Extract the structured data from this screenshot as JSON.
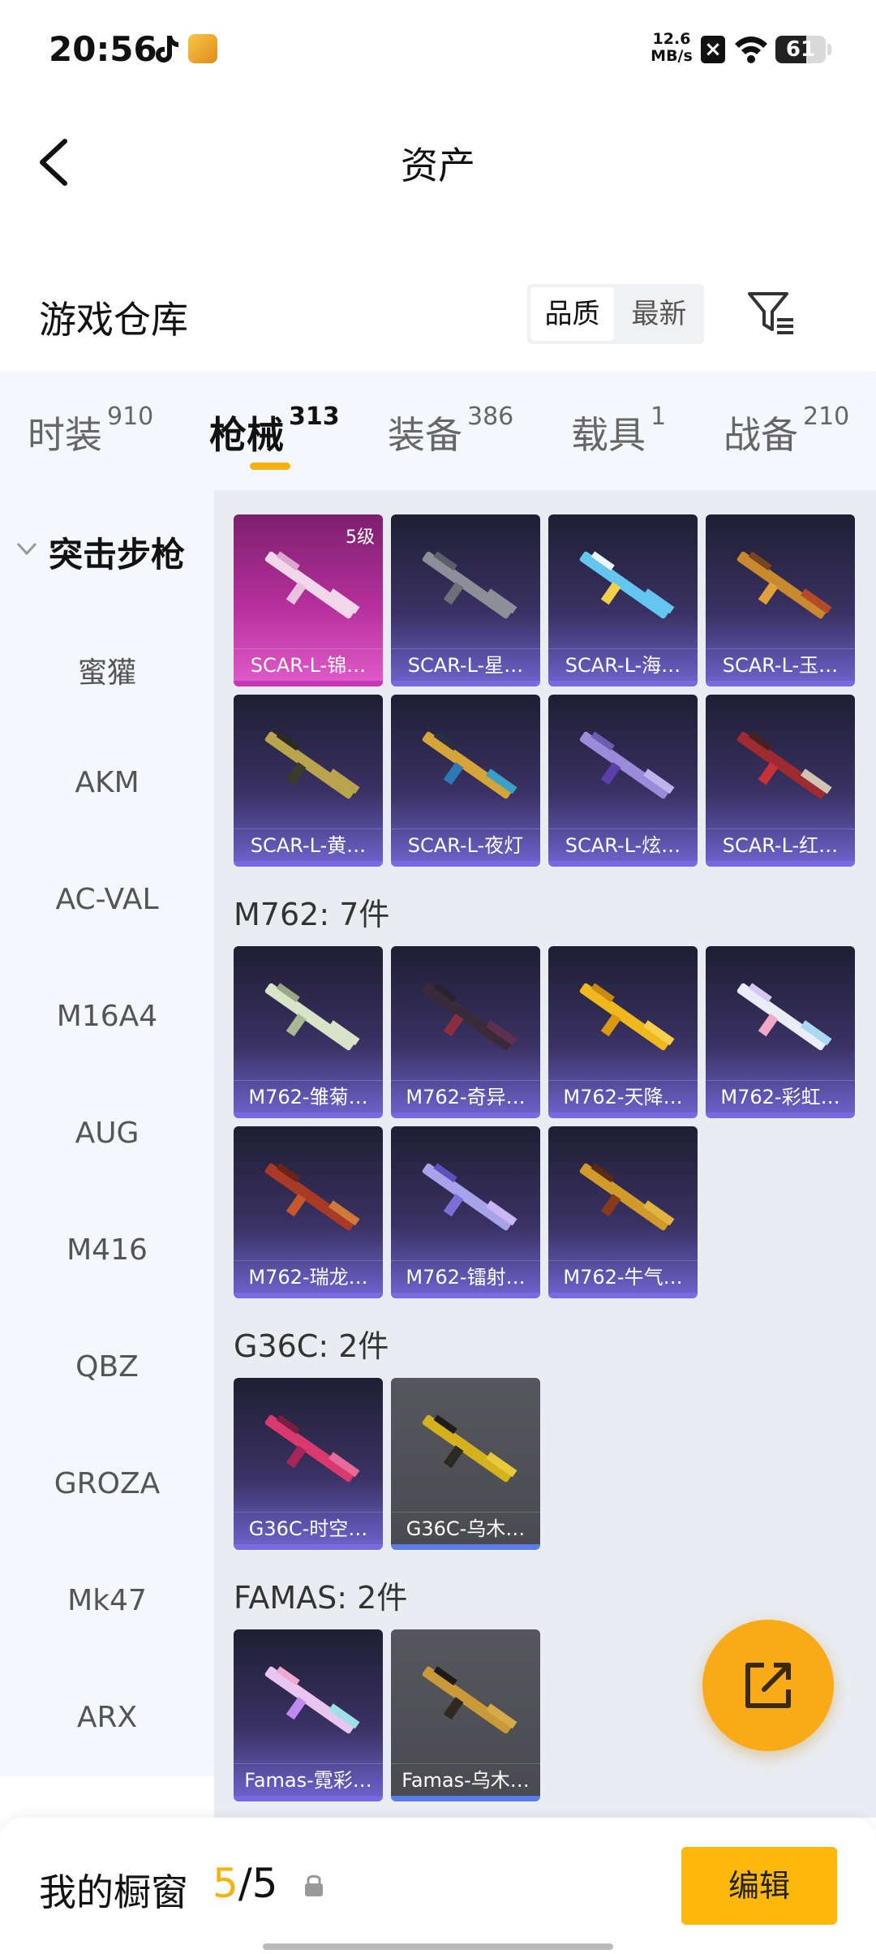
{
  "status_bar": {
    "time": "20:56",
    "net_speed_value": "12.6",
    "net_speed_unit": "MB/s",
    "battery": "61",
    "battery_level": 0.61
  },
  "header": {
    "title": "资产",
    "back_icon": "back-arrow-icon"
  },
  "warehouse": {
    "title": "游戏仓库",
    "sort_options": [
      "品质",
      "最新"
    ],
    "active_sort": "品质",
    "filter_icon": "filter-icon"
  },
  "tabs": [
    {
      "label": "时装",
      "count": "910"
    },
    {
      "label": "枪械",
      "count": "313",
      "active": true
    },
    {
      "label": "装备",
      "count": "386"
    },
    {
      "label": "载具",
      "count": "1"
    },
    {
      "label": "战备",
      "count": "210"
    }
  ],
  "rail": {
    "heading": "突击步枪",
    "items": [
      "蜜獾",
      "AKM",
      "AC-VAL",
      "M16A4",
      "AUG",
      "M416",
      "QBZ",
      "GROZA",
      "Mk47",
      "ARX"
    ]
  },
  "sections": [
    {
      "title": "",
      "items": [
        {
          "label": "SCAR-L-锦…",
          "badge": "5级",
          "style": "pink"
        },
        {
          "label": "SCAR-L-星…"
        },
        {
          "label": "SCAR-L-海…"
        },
        {
          "label": "SCAR-L-玉…"
        },
        {
          "label": "SCAR-L-黄…"
        },
        {
          "label": "SCAR-L-夜灯"
        },
        {
          "label": "SCAR-L-炫…"
        },
        {
          "label": "SCAR-L-红…"
        }
      ]
    },
    {
      "title": "M762: 7件",
      "items": [
        {
          "label": "M762-雏菊…"
        },
        {
          "label": "M762-奇异…"
        },
        {
          "label": "M762-天降…"
        },
        {
          "label": "M762-彩虹…"
        },
        {
          "label": "M762-瑞龙…"
        },
        {
          "label": "M762-镭射…"
        },
        {
          "label": "M762-牛气…"
        }
      ]
    },
    {
      "title": "G36C: 2件",
      "items": [
        {
          "label": "G36C-时空…"
        },
        {
          "label": "G36C-乌木…",
          "style": "gray"
        }
      ]
    },
    {
      "title": "FAMAS: 2件",
      "items": [
        {
          "label": "Famas-霓彩…"
        },
        {
          "label": "Famas-乌木…",
          "style": "gray"
        }
      ]
    }
  ],
  "fab": {
    "icon": "share-export-icon"
  },
  "bottom_bar": {
    "label": "我的橱窗",
    "count_current": "5",
    "count_total": "/5",
    "lock_icon": "lock-icon",
    "edit_label": "编辑"
  },
  "colors": {
    "accent": "#f5b211",
    "card_purple": "#6c60c8",
    "card_pink": "#de58c7",
    "card_gray": "#4a4b50"
  }
}
